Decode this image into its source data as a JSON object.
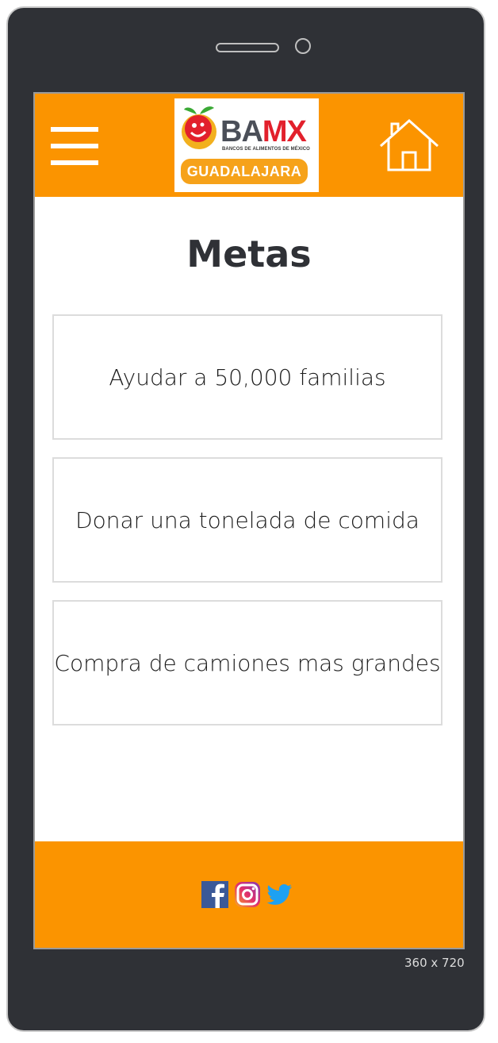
{
  "device": {
    "dimension_label": "360 x 720"
  },
  "header": {
    "logo": {
      "title_part1": "BA",
      "title_part2": "MX",
      "subtitle": "BANCOS DE ALIMENTOS DE MÉXICO",
      "banner": "GUADALAJARA"
    },
    "menu_icon": "hamburger-menu-icon",
    "home_icon": "home-icon"
  },
  "page": {
    "title": "Metas"
  },
  "goals": [
    {
      "label": "Ayudar a 50,000 familias"
    },
    {
      "label": "Donar una tonelada de comida"
    },
    {
      "label": "Compra de camiones mas grandes"
    }
  ],
  "footer": {
    "social": [
      "facebook-icon",
      "instagram-icon",
      "twitter-icon"
    ]
  },
  "colors": {
    "header_bg": "#fb9400",
    "frame": "#2f3136",
    "title": "#2f3136",
    "brand_red": "#e2202c",
    "brand_gray": "#4b4f58"
  }
}
